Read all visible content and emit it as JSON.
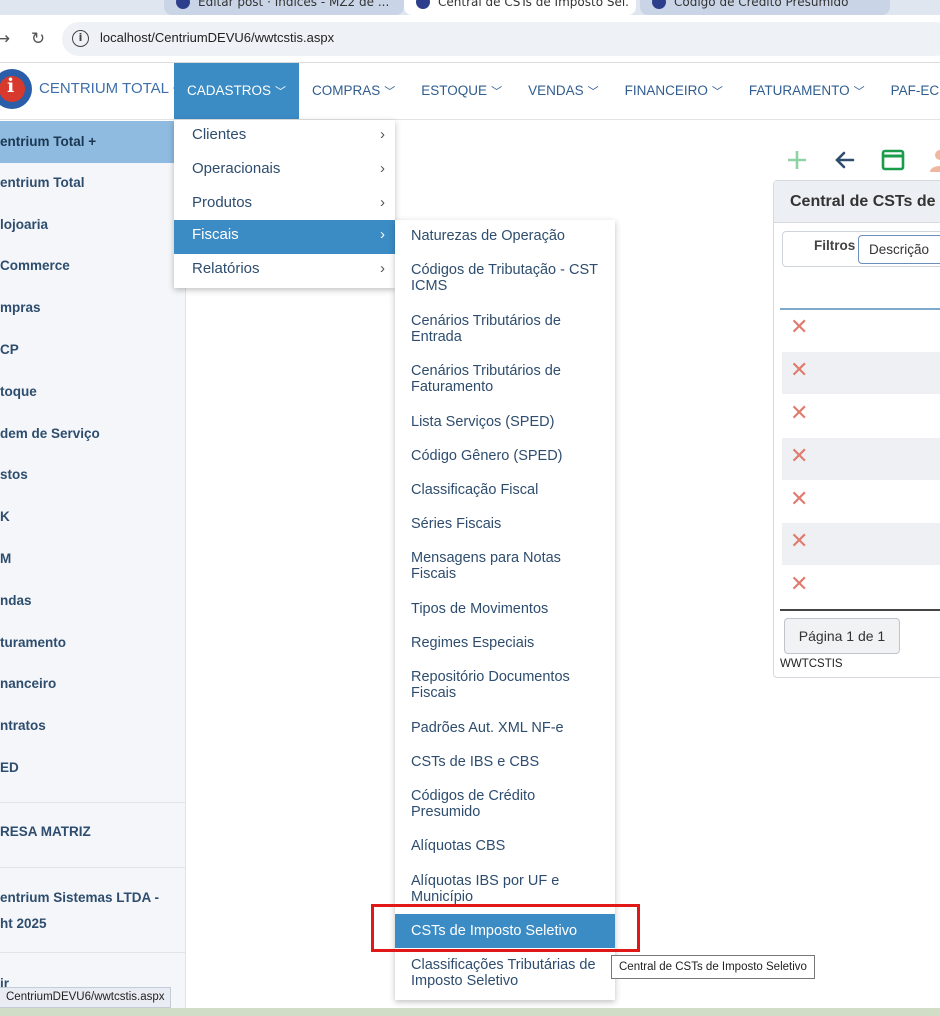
{
  "browser": {
    "tabs": [
      {
        "title": "Editar post · Índices - MZ2 de ...",
        "active": false
      },
      {
        "title": "Central de CSTs de Imposto Sel...",
        "active": true
      },
      {
        "title": "Código de Crédito Presumido",
        "active": false
      }
    ],
    "url": "localhost/CentriumDEVU6/wwtcstis.aspx",
    "status_url": "CentriumDEVU6/wwtcstis.aspx"
  },
  "app": {
    "brand": "CENTRIUM TOTAL +",
    "logo_letter": "i",
    "colors": {
      "accent": "#3b8bc4",
      "brand": "#3f6fa8",
      "highlight": "#e01818"
    }
  },
  "topmenu": [
    {
      "label": "CADASTROS",
      "active": true
    },
    {
      "label": "COMPRAS",
      "active": false
    },
    {
      "label": "ESTOQUE",
      "active": false
    },
    {
      "label": "VENDAS",
      "active": false
    },
    {
      "label": "FINANCEIRO",
      "active": false
    },
    {
      "label": "FATURAMENTO",
      "active": false
    },
    {
      "label": "PAF-ECF",
      "active": false
    }
  ],
  "sidebar": {
    "items": [
      "entrium Total +",
      "entrium Total",
      "lojoaria",
      "Commerce",
      "mpras",
      "CP",
      "toque",
      "dem de Serviço",
      "stos",
      "K",
      "M",
      "ndas",
      "turamento",
      "nanceiro",
      "ntratos",
      "ED"
    ],
    "company": "RESA MATRIZ",
    "copyright_line1": "entrium Sistemas LTDA -",
    "copyright_line2": "ht 2025",
    "exit": "ir"
  },
  "menu_cadastros": [
    {
      "label": "Clientes",
      "active": false
    },
    {
      "label": "Operacionais",
      "active": false
    },
    {
      "label": "Produtos",
      "active": false
    },
    {
      "label": "Fiscais",
      "active": true
    },
    {
      "label": "Relatórios",
      "active": false
    }
  ],
  "menu_fiscais": [
    {
      "label": "Naturezas de Operação"
    },
    {
      "label": "Códigos de Tributação - CST ICMS"
    },
    {
      "label": "Cenários Tributários de Entrada"
    },
    {
      "label": "Cenários Tributários de Faturamento"
    },
    {
      "label": "Lista Serviços (SPED)"
    },
    {
      "label": "Código Gênero (SPED)"
    },
    {
      "label": "Classificação Fiscal"
    },
    {
      "label": "Séries Fiscais"
    },
    {
      "label": "Mensagens para Notas Fiscais"
    },
    {
      "label": "Tipos de Movimentos"
    },
    {
      "label": "Regimes Especiais"
    },
    {
      "label": "Repositório Documentos Fiscais"
    },
    {
      "label": "Padrões Aut. XML NF-e"
    },
    {
      "label": "CSTs de IBS e CBS"
    },
    {
      "label": "Códigos de Crédito Presumido"
    },
    {
      "label": "Alíquotas CBS"
    },
    {
      "label": "Alíquotas IBS por UF e Município"
    },
    {
      "label": "CSTs de Imposto Seletivo",
      "active": true
    },
    {
      "label": "Classificações Tributárias de Imposto Seletivo"
    }
  ],
  "tooltip": "Central de CSTs de Imposto Seletivo",
  "main": {
    "panel_title": "Central de CSTs de",
    "filter_label": "Filtros",
    "filter_select": "Descrição",
    "row_count": 7,
    "pager": "Página 1 de 1",
    "program_name": "WWTCSTIS",
    "toolbar_icons": [
      "plus-icon",
      "back-arrow-icon",
      "window-icon",
      "user-icon"
    ]
  }
}
